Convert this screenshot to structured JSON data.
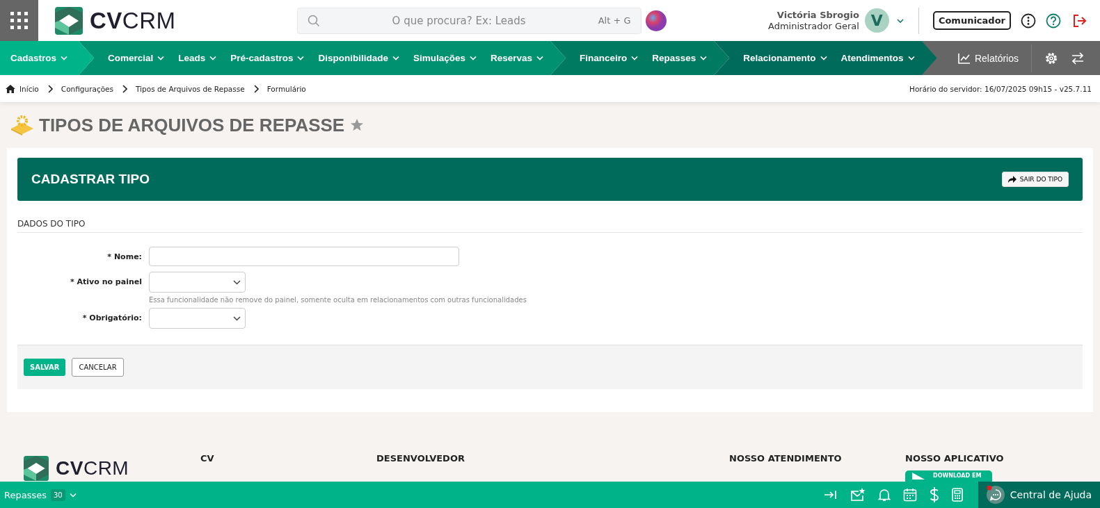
{
  "header": {
    "logo_text_bold": "CV",
    "logo_text": "CRM",
    "search": {
      "placeholder": "O que procura? Ex: Leads",
      "shortcut": "Alt + G"
    },
    "user": {
      "name": "Victória Sbrogio",
      "role": "Administrador Geral",
      "initial": "V"
    },
    "communicator_button": "Comunicador"
  },
  "nav": {
    "groups": [
      {
        "color": "#00b388",
        "items": [
          {
            "label": "Cadastros"
          }
        ]
      },
      {
        "color": "#009270",
        "items": [
          {
            "label": "Comercial"
          },
          {
            "label": "Leads"
          },
          {
            "label": "Pré-cadastros"
          },
          {
            "label": "Disponibilidade"
          },
          {
            "label": "Simulações"
          },
          {
            "label": "Reservas"
          }
        ]
      },
      {
        "color": "#007a60",
        "items": [
          {
            "label": "Financeiro"
          },
          {
            "label": "Repasses"
          }
        ]
      },
      {
        "color": "#006b5a",
        "items": [
          {
            "label": "Relacionamento"
          },
          {
            "label": "Atendimentos"
          }
        ]
      }
    ],
    "reports": "Relatórios"
  },
  "breadcrumb": [
    "Início",
    "Configurações",
    "Tipos de Arquivos de Repasse",
    "Formulário"
  ],
  "server_time": "Horário do servidor: 16/07/2025 09h15 - v25.7.11",
  "page_title": "TIPOS DE ARQUIVOS DE REPASSE",
  "form": {
    "title": "CADASTRAR TIPO",
    "exit_button": "SAIR DO TIPO",
    "section": "DADOS DO TIPO",
    "fields": [
      {
        "kind": "text",
        "label": "* Nome:"
      },
      {
        "kind": "select",
        "label": "* Ativo no painel",
        "help": "Essa funcionalidade não remove do painel, somente oculta em relacionamentos com outras funcionalidades"
      },
      {
        "kind": "select",
        "label": "* Obrigatório:"
      }
    ],
    "buttons": [
      {
        "kind": "primary",
        "label": "SALVAR"
      },
      {
        "kind": "secondary",
        "label": "CANCELAR"
      }
    ]
  },
  "footer": {
    "logo_text_bold": "CV",
    "logo_text": "CRM",
    "columns": [
      {
        "title": "CV"
      },
      {
        "title": "DESENVOLVEDOR"
      },
      {
        "title": "NOSSO ATENDIMENTO"
      },
      {
        "title": "NOSSO APLICATIVO",
        "badge": "DOWNLOAD EM"
      }
    ]
  },
  "bottom_bar": {
    "label": "Repasses",
    "count": "30",
    "help": "Central de Ajuda"
  }
}
